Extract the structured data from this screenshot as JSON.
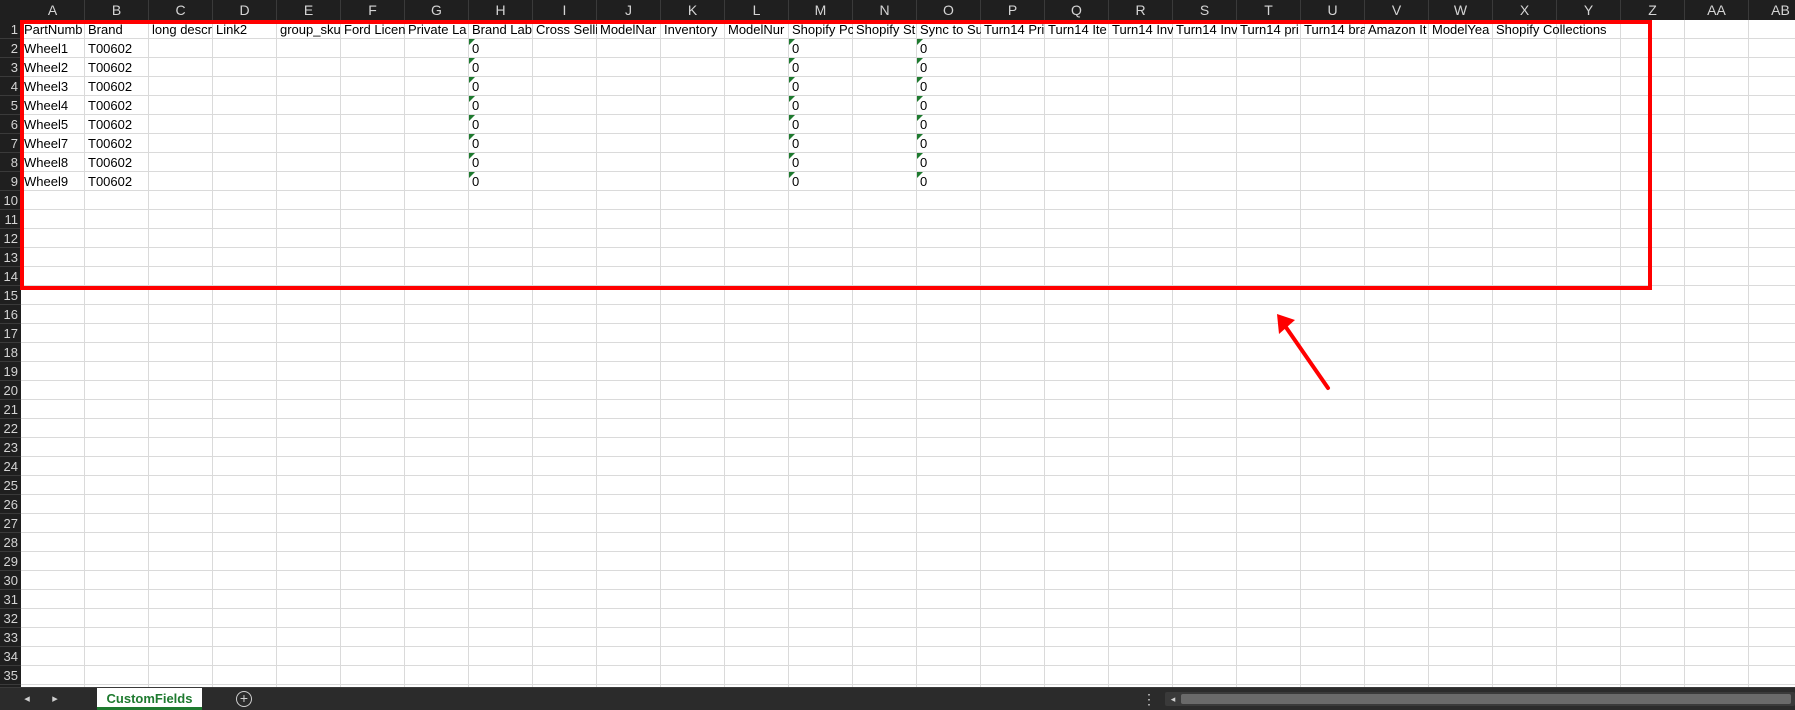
{
  "columns": [
    "A",
    "B",
    "C",
    "D",
    "E",
    "F",
    "G",
    "H",
    "I",
    "J",
    "K",
    "L",
    "M",
    "N",
    "O",
    "P",
    "Q",
    "R",
    "S",
    "T",
    "U",
    "V",
    "W",
    "X",
    "Y",
    "Z",
    "AA",
    "AB"
  ],
  "row_numbers": [
    "1",
    "2",
    "3",
    "4",
    "5",
    "6",
    "7",
    "8",
    "9",
    "10",
    "11",
    "12",
    "13",
    "14",
    "15",
    "16",
    "17",
    "18",
    "19",
    "20",
    "21",
    "22",
    "23",
    "24",
    "25",
    "26",
    "27",
    "28",
    "29",
    "30",
    "31",
    "32",
    "33",
    "34",
    "35"
  ],
  "headers": [
    "PartNumb",
    "Brand",
    "long descr",
    "Link2",
    "group_sku",
    "Ford Licen",
    "Private La",
    "Brand Lab",
    "Cross Selli",
    "ModelNar",
    "Inventory",
    "ModelNur",
    "Shopify Pc",
    "Shopify St",
    "Sync to Su",
    "Turn14 Pri",
    "Turn14 Ite",
    "Turn14 Inv",
    "Turn14 Inv",
    "Turn14 pri",
    "Turn14 bra",
    "Amazon It",
    "ModelYea",
    "Shopify Collections"
  ],
  "rows": [
    {
      "part": "Wheel1",
      "brand": "T00602",
      "h": "0",
      "m": "0",
      "o": "0"
    },
    {
      "part": "Wheel2",
      "brand": "T00602",
      "h": "0",
      "m": "0",
      "o": "0"
    },
    {
      "part": "Wheel3",
      "brand": "T00602",
      "h": "0",
      "m": "0",
      "o": "0"
    },
    {
      "part": "Wheel4",
      "brand": "T00602",
      "h": "0",
      "m": "0",
      "o": "0"
    },
    {
      "part": "Wheel5",
      "brand": "T00602",
      "h": "0",
      "m": "0",
      "o": "0"
    },
    {
      "part": "Wheel7",
      "brand": "T00602",
      "h": "0",
      "m": "0",
      "o": "0"
    },
    {
      "part": "Wheel8",
      "brand": "T00602",
      "h": "0",
      "m": "0",
      "o": "0"
    },
    {
      "part": "Wheel9",
      "brand": "T00602",
      "h": "0",
      "m": "0",
      "o": "0"
    }
  ],
  "tabbar": {
    "sheet_name": "CustomFields",
    "add_sheet": "+",
    "dots": "⋮",
    "nav_prev": "◂",
    "nav_next": "▸",
    "scroll_left": "◂"
  },
  "colors": {
    "annotation": "#ff0000",
    "accent": "#1e7a2f",
    "header_bg": "#1f1f1f"
  }
}
